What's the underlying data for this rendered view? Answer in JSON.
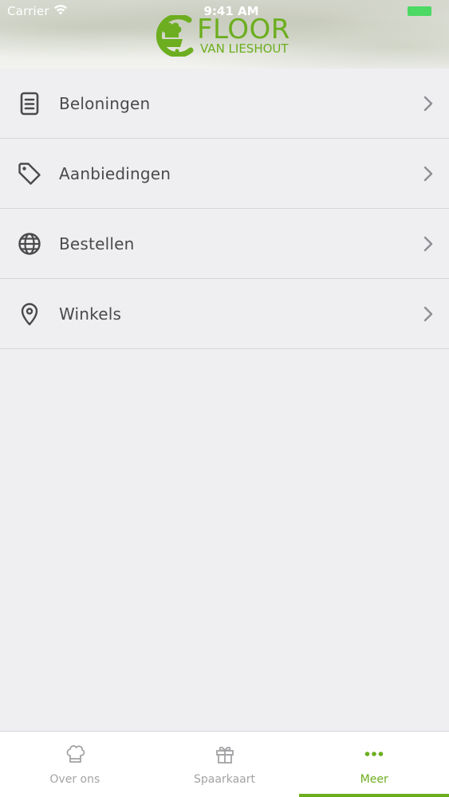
{
  "status_bar": {
    "carrier": "Carrier",
    "time": "9:41 AM"
  },
  "brand": {
    "title": "FLOOR",
    "subtitle": "VAN LIESHOUT",
    "logo_icon": "chef-cart-logo",
    "color": "#6cae1f"
  },
  "menu": {
    "items": [
      {
        "label": "Beloningen",
        "icon": "document-list-icon"
      },
      {
        "label": "Aanbiedingen",
        "icon": "tag-icon"
      },
      {
        "label": "Bestellen",
        "icon": "globe-icon"
      },
      {
        "label": "Winkels",
        "icon": "map-pin-icon"
      }
    ]
  },
  "tabbar": {
    "tabs": [
      {
        "label": "Over ons",
        "icon": "chef-hat-icon",
        "active": false
      },
      {
        "label": "Spaarkaart",
        "icon": "gift-icon",
        "active": false
      },
      {
        "label": "Meer",
        "icon": "more-dots-icon",
        "active": true
      }
    ],
    "active_color": "#6cae1f",
    "inactive_color": "#a3a3a6"
  }
}
